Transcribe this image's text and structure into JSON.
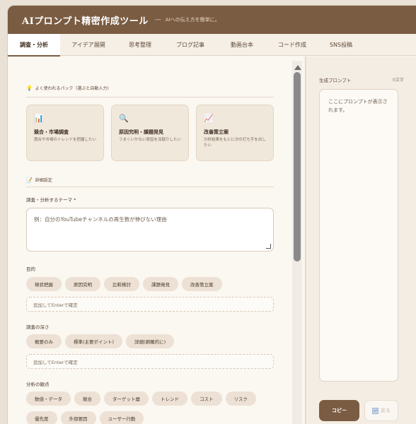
{
  "header": {
    "title": "AIプロンプト精密作成ツール",
    "separator": "—",
    "subtitle": "AIへの伝え方を簡単に。"
  },
  "tabs": [
    {
      "label": "調査・分析",
      "active": true
    },
    {
      "label": "アイデア展開",
      "active": false
    },
    {
      "label": "思考整理",
      "active": false
    },
    {
      "label": "ブログ記事",
      "active": false
    },
    {
      "label": "動画台本",
      "active": false
    },
    {
      "label": "コード作成",
      "active": false
    },
    {
      "label": "SNS投稿",
      "active": false
    }
  ],
  "packs": {
    "heading": "よく使われるパック（選ぶと自動入力）",
    "heading_icon": "lightbulb-icon",
    "items": [
      {
        "icon": "bar-chart-icon",
        "glyph": "📊",
        "title": "競合・市場調査",
        "desc": "競合や市場のトレンドを把握したい"
      },
      {
        "icon": "magnifier-icon",
        "glyph": "🔍",
        "title": "原因究明・課題発見",
        "desc": "うまくいかない原因を深掘りしたい"
      },
      {
        "icon": "trend-up-icon",
        "glyph": "📈",
        "title": "改善策立案",
        "desc": "分析結果をもとに次の打ち手を出したい"
      }
    ]
  },
  "details": {
    "heading": "詳細設定",
    "heading_icon": "memo-icon",
    "theme_label": "調査・分析するテーマ *",
    "theme_placeholder": "例：自分のYouTubeチャンネルの再生数が伸びない理由",
    "purpose_label": "目的",
    "purpose_chips": [
      "現状把握",
      "原因究明",
      "比較検討",
      "課題発見",
      "改善策立案"
    ],
    "purpose_add_placeholder": "追加してEnterで確定",
    "depth_label": "調査の深さ",
    "depth_chips": [
      "概要のみ",
      "標準(主要ポイント)",
      "詳細(網羅的に)"
    ],
    "depth_add_placeholder": "追加してEnterで確定",
    "viewpoint_label": "分析の観点",
    "viewpoint_chips": [
      "数値・データ",
      "競合",
      "ターゲット層",
      "トレンド",
      "コスト",
      "リスク",
      "優先度",
      "外部要因",
      "ユーザー行動"
    ]
  },
  "output": {
    "label": "生成プロンプト",
    "count": "0文字",
    "placeholder": "ここにプロンプトが表示されます。",
    "copy_label": "コピー",
    "back_label": "戻る"
  },
  "colors": {
    "brand": "#7a5c42",
    "background": "#f8f3ec",
    "chip": "#ece1d4"
  }
}
